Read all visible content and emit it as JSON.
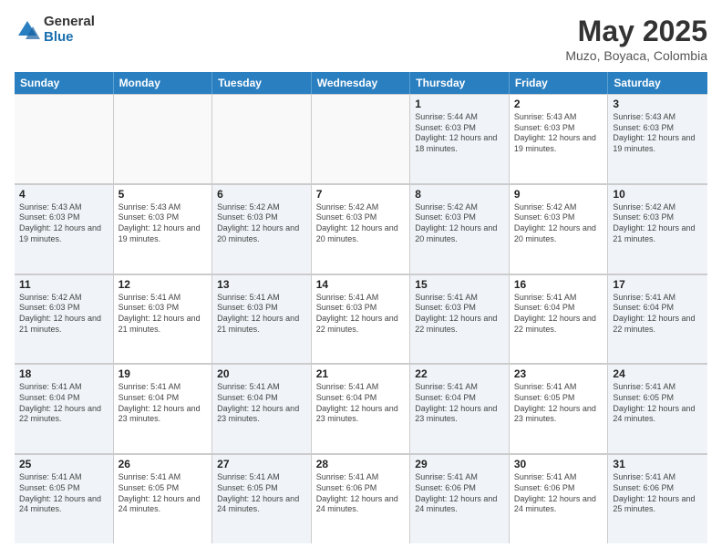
{
  "logo": {
    "general": "General",
    "blue": "Blue"
  },
  "title": "May 2025",
  "location": "Muzo, Boyaca, Colombia",
  "header_days": [
    "Sunday",
    "Monday",
    "Tuesday",
    "Wednesday",
    "Thursday",
    "Friday",
    "Saturday"
  ],
  "weeks": [
    [
      {
        "day": "",
        "info": "",
        "empty": true
      },
      {
        "day": "",
        "info": "",
        "empty": true
      },
      {
        "day": "",
        "info": "",
        "empty": true
      },
      {
        "day": "",
        "info": "",
        "empty": true
      },
      {
        "day": "1",
        "info": "Sunrise: 5:44 AM\nSunset: 6:03 PM\nDaylight: 12 hours and 18 minutes.",
        "empty": false
      },
      {
        "day": "2",
        "info": "Sunrise: 5:43 AM\nSunset: 6:03 PM\nDaylight: 12 hours and 19 minutes.",
        "empty": false
      },
      {
        "day": "3",
        "info": "Sunrise: 5:43 AM\nSunset: 6:03 PM\nDaylight: 12 hours and 19 minutes.",
        "empty": false
      }
    ],
    [
      {
        "day": "4",
        "info": "Sunrise: 5:43 AM\nSunset: 6:03 PM\nDaylight: 12 hours and 19 minutes.",
        "empty": false
      },
      {
        "day": "5",
        "info": "Sunrise: 5:43 AM\nSunset: 6:03 PM\nDaylight: 12 hours and 19 minutes.",
        "empty": false
      },
      {
        "day": "6",
        "info": "Sunrise: 5:42 AM\nSunset: 6:03 PM\nDaylight: 12 hours and 20 minutes.",
        "empty": false
      },
      {
        "day": "7",
        "info": "Sunrise: 5:42 AM\nSunset: 6:03 PM\nDaylight: 12 hours and 20 minutes.",
        "empty": false
      },
      {
        "day": "8",
        "info": "Sunrise: 5:42 AM\nSunset: 6:03 PM\nDaylight: 12 hours and 20 minutes.",
        "empty": false
      },
      {
        "day": "9",
        "info": "Sunrise: 5:42 AM\nSunset: 6:03 PM\nDaylight: 12 hours and 20 minutes.",
        "empty": false
      },
      {
        "day": "10",
        "info": "Sunrise: 5:42 AM\nSunset: 6:03 PM\nDaylight: 12 hours and 21 minutes.",
        "empty": false
      }
    ],
    [
      {
        "day": "11",
        "info": "Sunrise: 5:42 AM\nSunset: 6:03 PM\nDaylight: 12 hours and 21 minutes.",
        "empty": false
      },
      {
        "day": "12",
        "info": "Sunrise: 5:41 AM\nSunset: 6:03 PM\nDaylight: 12 hours and 21 minutes.",
        "empty": false
      },
      {
        "day": "13",
        "info": "Sunrise: 5:41 AM\nSunset: 6:03 PM\nDaylight: 12 hours and 21 minutes.",
        "empty": false
      },
      {
        "day": "14",
        "info": "Sunrise: 5:41 AM\nSunset: 6:03 PM\nDaylight: 12 hours and 22 minutes.",
        "empty": false
      },
      {
        "day": "15",
        "info": "Sunrise: 5:41 AM\nSunset: 6:03 PM\nDaylight: 12 hours and 22 minutes.",
        "empty": false
      },
      {
        "day": "16",
        "info": "Sunrise: 5:41 AM\nSunset: 6:04 PM\nDaylight: 12 hours and 22 minutes.",
        "empty": false
      },
      {
        "day": "17",
        "info": "Sunrise: 5:41 AM\nSunset: 6:04 PM\nDaylight: 12 hours and 22 minutes.",
        "empty": false
      }
    ],
    [
      {
        "day": "18",
        "info": "Sunrise: 5:41 AM\nSunset: 6:04 PM\nDaylight: 12 hours and 22 minutes.",
        "empty": false
      },
      {
        "day": "19",
        "info": "Sunrise: 5:41 AM\nSunset: 6:04 PM\nDaylight: 12 hours and 23 minutes.",
        "empty": false
      },
      {
        "day": "20",
        "info": "Sunrise: 5:41 AM\nSunset: 6:04 PM\nDaylight: 12 hours and 23 minutes.",
        "empty": false
      },
      {
        "day": "21",
        "info": "Sunrise: 5:41 AM\nSunset: 6:04 PM\nDaylight: 12 hours and 23 minutes.",
        "empty": false
      },
      {
        "day": "22",
        "info": "Sunrise: 5:41 AM\nSunset: 6:04 PM\nDaylight: 12 hours and 23 minutes.",
        "empty": false
      },
      {
        "day": "23",
        "info": "Sunrise: 5:41 AM\nSunset: 6:05 PM\nDaylight: 12 hours and 23 minutes.",
        "empty": false
      },
      {
        "day": "24",
        "info": "Sunrise: 5:41 AM\nSunset: 6:05 PM\nDaylight: 12 hours and 24 minutes.",
        "empty": false
      }
    ],
    [
      {
        "day": "25",
        "info": "Sunrise: 5:41 AM\nSunset: 6:05 PM\nDaylight: 12 hours and 24 minutes.",
        "empty": false
      },
      {
        "day": "26",
        "info": "Sunrise: 5:41 AM\nSunset: 6:05 PM\nDaylight: 12 hours and 24 minutes.",
        "empty": false
      },
      {
        "day": "27",
        "info": "Sunrise: 5:41 AM\nSunset: 6:05 PM\nDaylight: 12 hours and 24 minutes.",
        "empty": false
      },
      {
        "day": "28",
        "info": "Sunrise: 5:41 AM\nSunset: 6:06 PM\nDaylight: 12 hours and 24 minutes.",
        "empty": false
      },
      {
        "day": "29",
        "info": "Sunrise: 5:41 AM\nSunset: 6:06 PM\nDaylight: 12 hours and 24 minutes.",
        "empty": false
      },
      {
        "day": "30",
        "info": "Sunrise: 5:41 AM\nSunset: 6:06 PM\nDaylight: 12 hours and 24 minutes.",
        "empty": false
      },
      {
        "day": "31",
        "info": "Sunrise: 5:41 AM\nSunset: 6:06 PM\nDaylight: 12 hours and 25 minutes.",
        "empty": false
      }
    ]
  ]
}
